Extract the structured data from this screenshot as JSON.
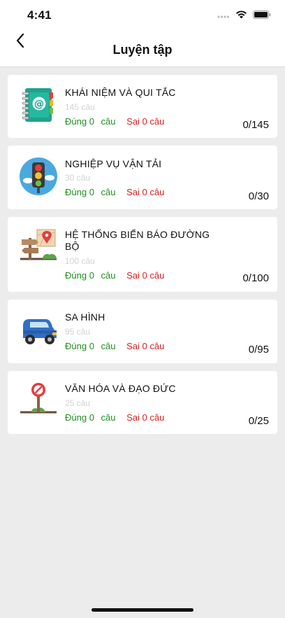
{
  "status_bar": {
    "time": "4:41"
  },
  "header": {
    "title": "Luyện tập"
  },
  "topics": [
    {
      "title": "KHÁI NIỆM VÀ QUI TẮC",
      "count": "145 câu",
      "correct": "Đúng 0",
      "unit": "câu",
      "wrong": "Sai 0 câu",
      "progress": "0/145",
      "icon": "address-book-icon"
    },
    {
      "title": "NGHIỆP VỤ VẬN TẢI",
      "count": "30 câu",
      "correct": "Đúng 0",
      "unit": "câu",
      "wrong": "Sai 0 câu",
      "progress": "0/30",
      "icon": "traffic-light-icon"
    },
    {
      "title": "HỆ THỐNG BIỂN BÁO ĐƯỜNG BỘ",
      "count": "100 câu",
      "correct": "Đúng 0",
      "unit": "câu",
      "wrong": "Sai 0 câu",
      "progress": "0/100",
      "icon": "signpost-map-icon"
    },
    {
      "title": "SA HÌNH",
      "count": "95 câu",
      "correct": "Đúng 0",
      "unit": "câu",
      "wrong": "Sai 0 câu",
      "progress": "0/95",
      "icon": "car-icon"
    },
    {
      "title": "VĂN HÓA VÀ ĐẠO ĐỨC",
      "count": "25 câu",
      "correct": "Đúng 0",
      "unit": "câu",
      "wrong": "Sai 0 câu",
      "progress": "0/25",
      "icon": "no-entry-sign-icon"
    }
  ]
}
